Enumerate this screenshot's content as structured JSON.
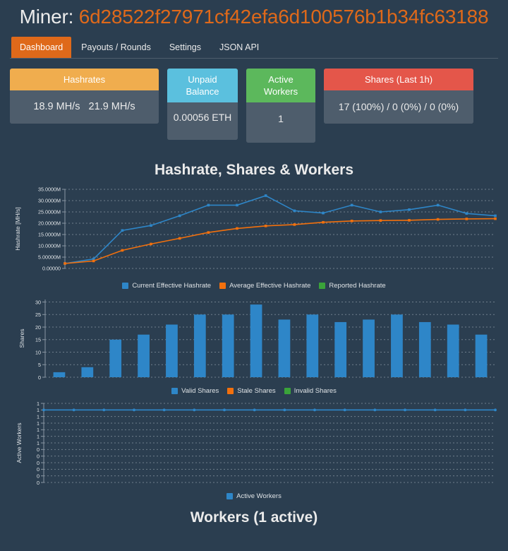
{
  "header": {
    "title_label": "Miner:",
    "miner_address": "6d28522f27971cf42efa6d100576b1b34fc63188",
    "accent_color": "#df691a"
  },
  "nav": {
    "tabs": [
      {
        "label": "Dashboard",
        "active": true
      },
      {
        "label": "Payouts / Rounds",
        "active": false
      },
      {
        "label": "Settings",
        "active": false
      },
      {
        "label": "JSON API",
        "active": false
      }
    ]
  },
  "stats": {
    "hashrates": {
      "title": "Hashrates",
      "value": "18.9 MH/s   21.9 MH/s",
      "current": "18.9 MH/s",
      "average": "21.9 MH/s",
      "header_color": "#f0ad4e"
    },
    "unpaid_balance": {
      "title": "Unpaid Balance",
      "value": "0.00056 ETH",
      "amount": "0.00056",
      "unit": "ETH",
      "header_color": "#5bc0de"
    },
    "active_workers": {
      "title": "Active Workers",
      "value": "1",
      "header_color": "#5cb85c"
    },
    "shares_last_1h": {
      "title": "Shares (Last 1h)",
      "value": "17 (100%) / 0 (0%) / 0 (0%)",
      "header_color": "#e4564a"
    }
  },
  "chart_section": {
    "title": "Hashrate, Shares & Workers",
    "footer_title": "Workers (1 active)"
  },
  "chart_data": [
    {
      "type": "line",
      "title": "Hashrate, Shares & Workers",
      "ylabel": "Hashrate [MH/s]",
      "xlabel": "",
      "ylim": [
        0,
        35000000
      ],
      "yticks": [
        0,
        5000000,
        10000000,
        15000000,
        20000000,
        25000000,
        30000000,
        35000000
      ],
      "ytick_labels": [
        "0.00000",
        "5.00000M",
        "10.0000M",
        "15.0000M",
        "20.0000M",
        "25.0000M",
        "30.0000M",
        "35.0000M"
      ],
      "grid": true,
      "legend_position": "bottom",
      "x": [
        0,
        1,
        2,
        3,
        4,
        5,
        6,
        7,
        8,
        9,
        10,
        11,
        12,
        13,
        14,
        15
      ],
      "series": [
        {
          "name": "Current Effective Hashrate",
          "color": "#2e86c8",
          "values": [
            2200000,
            4200000,
            16800000,
            19000000,
            23300000,
            28000000,
            28000000,
            32200000,
            25500000,
            24500000,
            28000000,
            25000000,
            26000000,
            28000000,
            24300000,
            23300000
          ]
        },
        {
          "name": "Average Effective Hashrate",
          "color": "#f2700d",
          "values": [
            2200000,
            3300000,
            8000000,
            10800000,
            13300000,
            15900000,
            17700000,
            18800000,
            19400000,
            20400000,
            21000000,
            21200000,
            21300000,
            21700000,
            21900000,
            22000000
          ]
        },
        {
          "name": "Reported Hashrate",
          "color": "#3aa33a",
          "values": []
        }
      ]
    },
    {
      "type": "bar",
      "ylabel": "Shares",
      "ylim": [
        0,
        31
      ],
      "yticks": [
        0,
        5,
        10,
        15,
        20,
        25,
        30
      ],
      "ytick_labels": [
        "0",
        "5",
        "10",
        "15",
        "20",
        "25",
        "30"
      ],
      "grid": true,
      "legend_position": "bottom",
      "categories": [
        "0",
        "1",
        "2",
        "3",
        "4",
        "5",
        "6",
        "7",
        "8",
        "9",
        "10",
        "11",
        "12",
        "13",
        "14",
        "15"
      ],
      "series": [
        {
          "name": "Valid Shares",
          "color": "#2e86c8",
          "values": [
            2,
            4,
            15,
            17,
            21,
            25,
            25,
            29,
            23,
            25,
            22,
            23,
            25,
            22,
            21,
            17
          ]
        },
        {
          "name": "Stale Shares",
          "color": "#f2700d",
          "values": [
            0,
            0,
            0,
            0,
            0,
            0,
            0,
            0,
            0,
            0,
            0,
            0,
            0,
            0,
            0,
            0
          ]
        },
        {
          "name": "Invalid Shares",
          "color": "#3aa33a",
          "values": [
            0,
            0,
            0,
            0,
            0,
            0,
            0,
            0,
            0,
            0,
            0,
            0,
            0,
            0,
            0,
            0
          ]
        }
      ]
    },
    {
      "type": "line",
      "ylabel": "Active Workers",
      "ylim": [
        0,
        1.08
      ],
      "ytick_labels": [
        "1",
        "1",
        "1",
        "1",
        "1",
        "1",
        "1",
        "0",
        "0",
        "0",
        "0",
        "0",
        "0"
      ],
      "grid": true,
      "legend_position": "bottom",
      "x": [
        0,
        1,
        2,
        3,
        4,
        5,
        6,
        7,
        8,
        9,
        10,
        11,
        12,
        13,
        14,
        15
      ],
      "series": [
        {
          "name": "Active Workers",
          "color": "#2e86c8",
          "values": [
            1,
            1,
            1,
            1,
            1,
            1,
            1,
            1,
            1,
            1,
            1,
            1,
            1,
            1,
            1,
            1
          ]
        }
      ]
    }
  ]
}
